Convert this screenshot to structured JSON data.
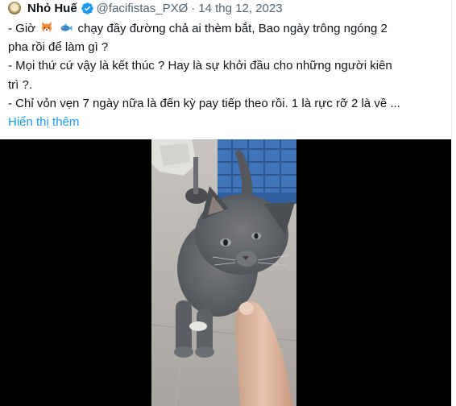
{
  "tweet": {
    "author": {
      "name": "Nhỏ Huế",
      "handle": "@facifistas_PXØ",
      "separator": "·",
      "date": "14 thg 12, 2023",
      "avatar_icon": "avatar-image",
      "verified_icon": "verified-badge-icon"
    },
    "text": {
      "line1_a": "- Giờ",
      "line1_b": "chạy đầy đường chả ai thèm bắt, Bao ngày trông ngóng 2",
      "line2": "pha rồi để làm gì ?",
      "line3": "- Mọi thứ cứ vậy là kết thúc ? Hay là sự khởi đầu cho những người kiên",
      "line4": "trì ?.",
      "line5": "- Chỉ vỏn vẹn 7 ngày nữa là đến kỳ pay tiếp theo rồi. 1 là rực rỡ 2 là về ...",
      "emoji1": "fox-emoji",
      "emoji2": "fish-emoji"
    },
    "show_more": "Hiển thị thêm",
    "media": {
      "type": "video",
      "description_icon": "kitten-video"
    }
  },
  "colors": {
    "text": "#0f1419",
    "secondary": "#536471",
    "link": "#1d9bf0",
    "verified": "#1d9bf0",
    "media_bg": "#000000",
    "border": "#e7e9ea"
  }
}
